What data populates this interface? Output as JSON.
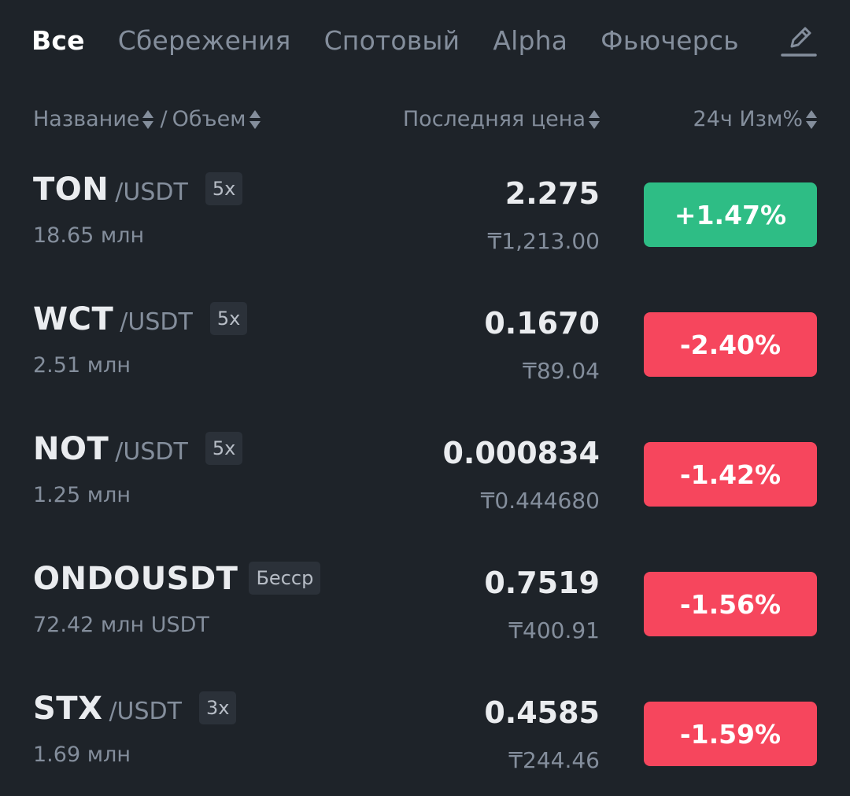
{
  "tabs": [
    {
      "label": "Все",
      "active": true
    },
    {
      "label": "Сбережения",
      "active": false
    },
    {
      "label": "Спотовый",
      "active": false
    },
    {
      "label": "Alpha",
      "active": false
    },
    {
      "label": "Фьючерсь",
      "active": false
    }
  ],
  "icons": {
    "edit": "pencil-edit-icon",
    "sort": "sort-arrows-icon"
  },
  "header": {
    "name": "Название",
    "separator": "/",
    "volume": "Объем",
    "last_price": "Последняя цена",
    "change_24h": "24ч Изм%"
  },
  "colors": {
    "background": "#1e2329",
    "up": "#2ebd85",
    "down": "#f6465d",
    "muted": "#848e9c",
    "badge": "#2b3139"
  },
  "rows": [
    {
      "base": "TON",
      "quote": "/USDT",
      "leverage": "5x",
      "volume": "18.65 млн",
      "price": "2.275",
      "fiat": "₸1,213.00",
      "change": "+1.47%",
      "direction": "up"
    },
    {
      "base": "WCT",
      "quote": "/USDT",
      "leverage": "5x",
      "volume": "2.51 млн",
      "price": "0.1670",
      "fiat": "₸89.04",
      "change": "-2.40%",
      "direction": "down"
    },
    {
      "base": "NOT",
      "quote": "/USDT",
      "leverage": "5x",
      "volume": "1.25 млн",
      "price": "0.000834",
      "fiat": "₸0.444680",
      "change": "-1.42%",
      "direction": "down"
    },
    {
      "base": "ONDOUSDT",
      "quote": "",
      "leverage": "Бесср",
      "volume": "72.42 млн USDT",
      "price": "0.7519",
      "fiat": "₸400.91",
      "change": "-1.56%",
      "direction": "down"
    },
    {
      "base": "STX",
      "quote": "/USDT",
      "leverage": "3x",
      "volume": "1.69 млн",
      "price": "0.4585",
      "fiat": "₸244.46",
      "change": "-1.59%",
      "direction": "down"
    }
  ]
}
